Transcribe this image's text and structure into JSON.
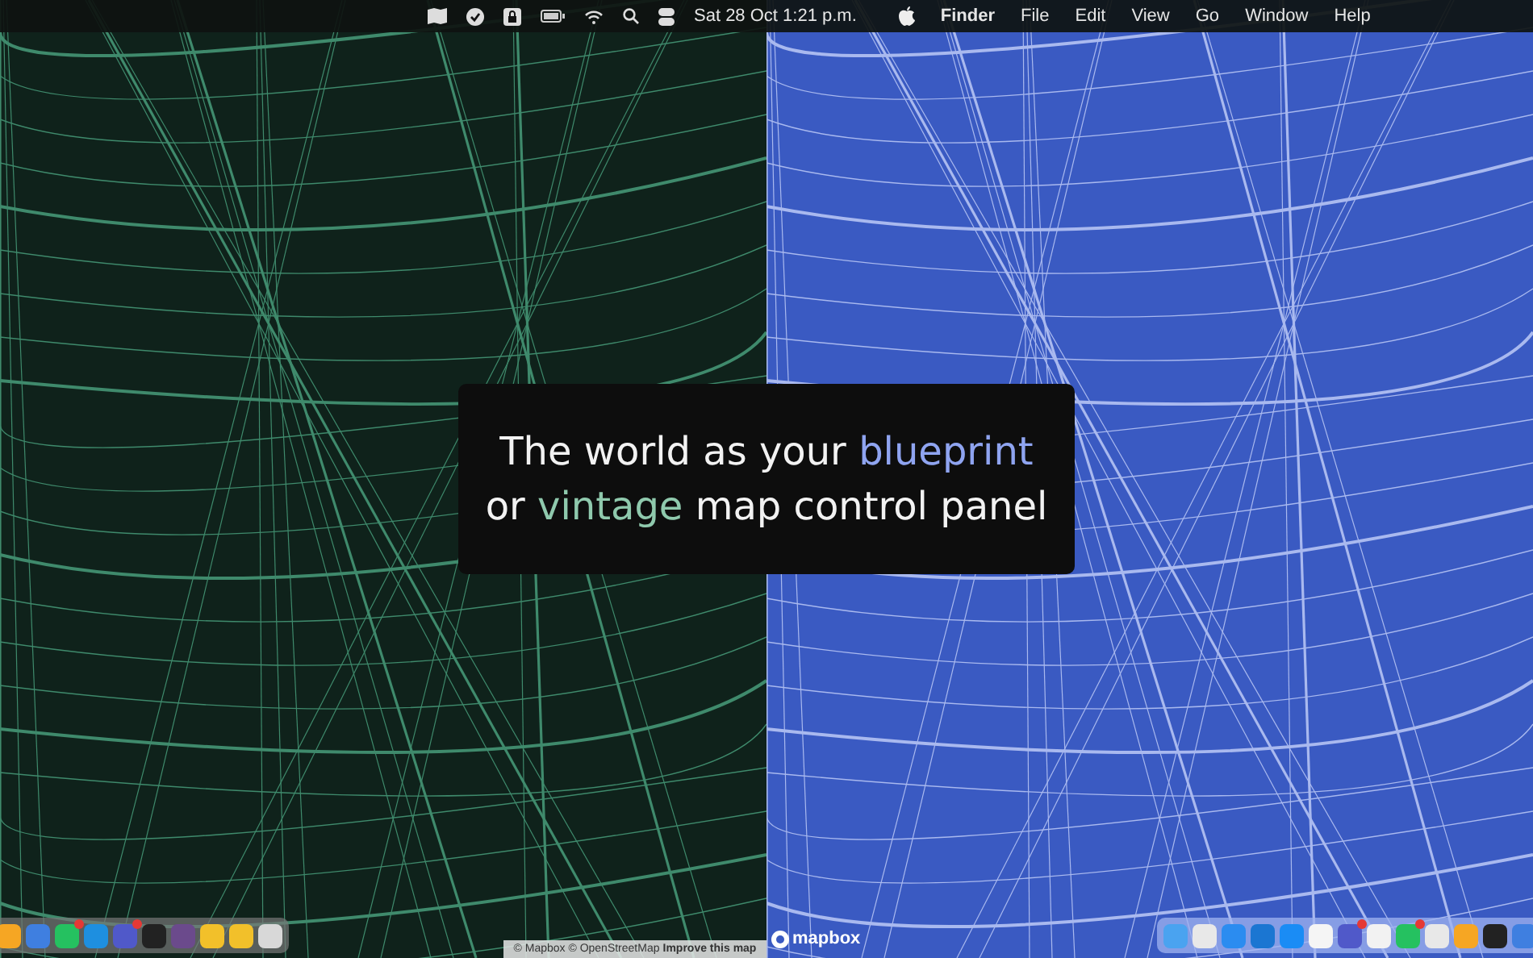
{
  "menu_bar": {
    "clock": "Sat 28 Oct  1:21 p.m.",
    "menus": [
      {
        "label": "Finder",
        "kind": "app"
      },
      {
        "label": "File",
        "kind": "menu"
      },
      {
        "label": "Edit",
        "kind": "menu"
      },
      {
        "label": "View",
        "kind": "menu"
      },
      {
        "label": "Go",
        "kind": "menu"
      },
      {
        "label": "Window",
        "kind": "menu"
      },
      {
        "label": "Help",
        "kind": "menu"
      }
    ]
  },
  "maps": [
    {
      "kind": "vintage"
    },
    {
      "kind": "blueprint"
    }
  ],
  "headline": {
    "lines": [
      [
        {
          "text": "The world as your "
        },
        {
          "text": "blueprint",
          "color": "#8fa4f0"
        }
      ],
      [
        {
          "text": "or "
        },
        {
          "text": "vintage",
          "color": "#8fc9ad"
        },
        {
          "text": " map control panel"
        }
      ]
    ]
  },
  "attribution": {
    "text": "© Mapbox © OpenStreetMap",
    "link": "Improve this map"
  },
  "logo": "mapbox",
  "docks": [
    {
      "icons": [
        {
          "color": "#f6a623",
          "badge": false
        },
        {
          "color": "#3f7fe0",
          "badge": false
        },
        {
          "color": "#25c160",
          "badge": true
        },
        {
          "color": "#1e8fe0",
          "badge": false
        },
        {
          "color": "#5059c9",
          "badge": true
        },
        {
          "color": "#222222",
          "badge": false
        },
        {
          "color": "#6b4a8c",
          "badge": false
        },
        {
          "color": "#f2c02a",
          "badge": false
        },
        {
          "color": "#f2c02a",
          "badge": false
        },
        {
          "color": "#d8d8d8",
          "badge": false
        }
      ]
    },
    {
      "icons": [
        {
          "color": "#4aa3f0",
          "badge": false
        },
        {
          "color": "#e8e8e8",
          "badge": false
        },
        {
          "color": "#2b8cf0",
          "badge": false
        },
        {
          "color": "#1b76d2",
          "badge": false
        },
        {
          "color": "#1a8cf5",
          "badge": false
        },
        {
          "color": "#f5f5f5",
          "badge": false
        },
        {
          "color": "#5059c9",
          "badge": true
        },
        {
          "color": "#f2f2f2",
          "badge": false
        },
        {
          "color": "#25c160",
          "badge": true
        },
        {
          "color": "#e8e8e8",
          "badge": false
        },
        {
          "color": "#f6a623",
          "badge": false
        },
        {
          "color": "#222222",
          "badge": false
        },
        {
          "color": "#3f7fe0",
          "badge": false
        }
      ]
    }
  ]
}
